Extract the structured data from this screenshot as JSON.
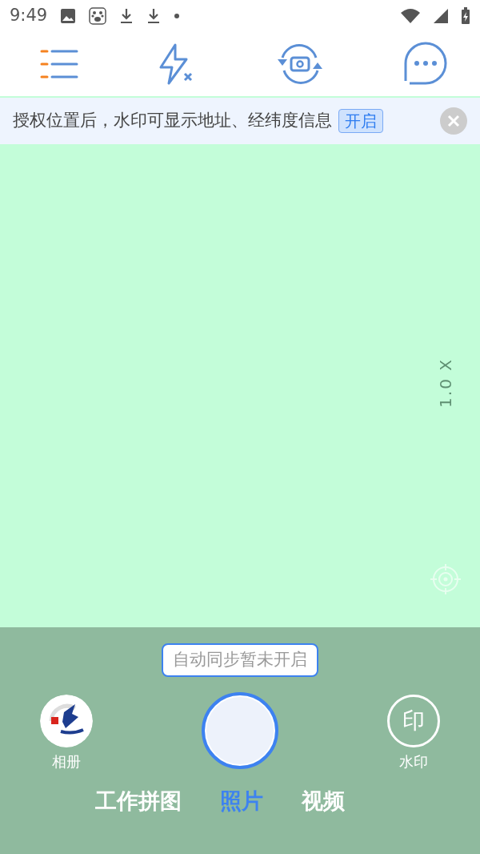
{
  "status_bar": {
    "time": "9:49"
  },
  "banner": {
    "text": "授权位置后，水印可显示地址、经纬度信息",
    "action": "开启"
  },
  "viewfinder": {
    "zoom": "1.0 X"
  },
  "sync_notice": "自动同步暂未开启",
  "album": {
    "label": "相册"
  },
  "watermark": {
    "glyph": "印",
    "label": "水印"
  },
  "modes": [
    {
      "label": "工作拼图",
      "selected": false
    },
    {
      "label": "照片",
      "selected": true
    },
    {
      "label": "视频",
      "selected": false
    }
  ]
}
